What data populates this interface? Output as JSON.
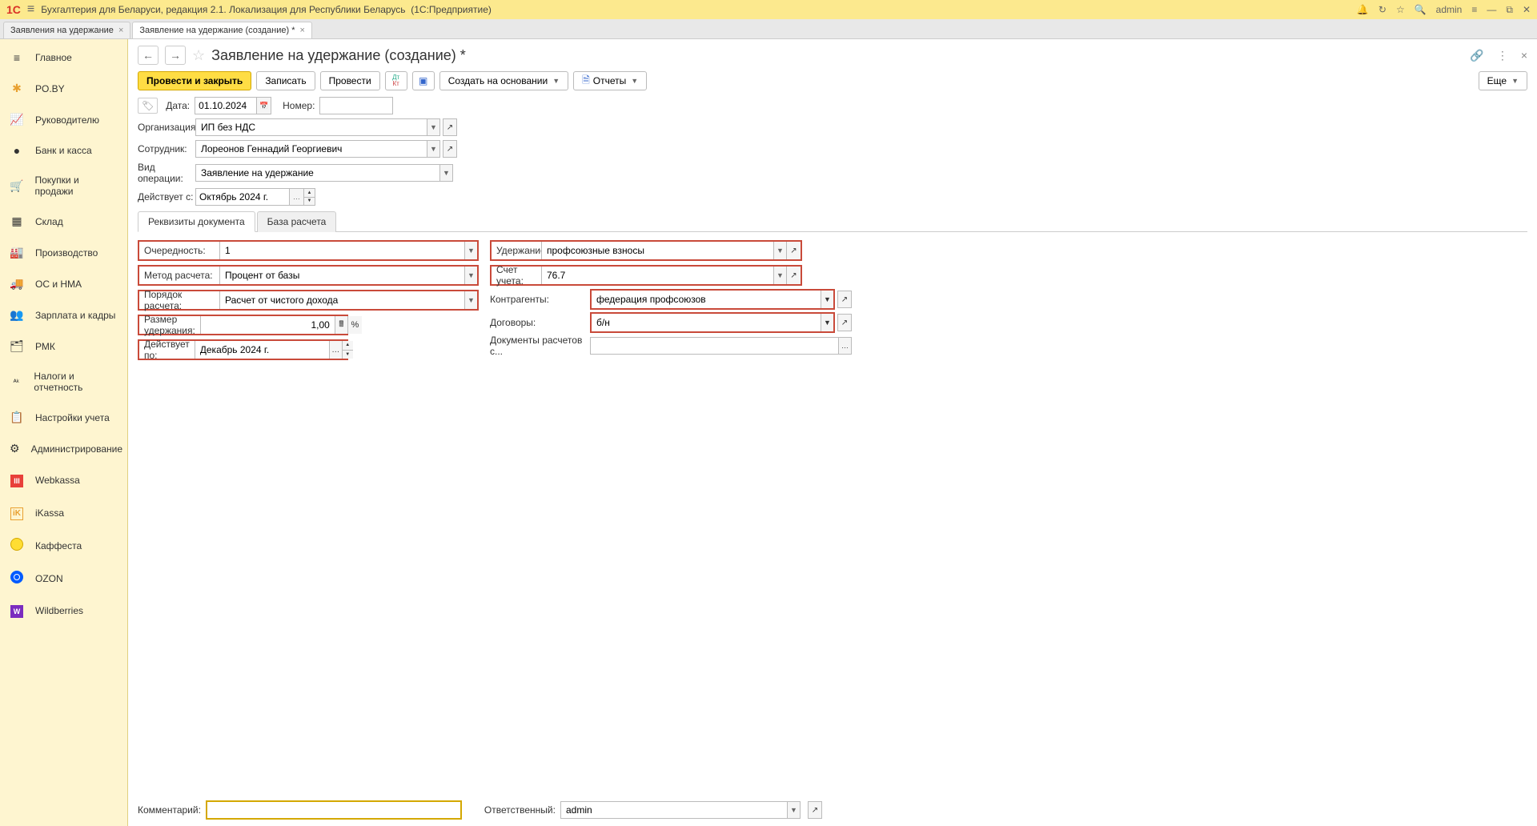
{
  "titlebar": {
    "app_title": "Бухгалтерия для Беларуси, редакция 2.1. Локализация для Республики Беларусь",
    "platform": "(1С:Предприятие)",
    "user": "admin"
  },
  "tabs": [
    {
      "label": "Заявления на удержание"
    },
    {
      "label": "Заявление на удержание (создание) *"
    }
  ],
  "sidebar": [
    {
      "label": "Главное",
      "icon": "≡"
    },
    {
      "label": "PO.BY",
      "icon": "✱"
    },
    {
      "label": "Руководителю",
      "icon": "📈"
    },
    {
      "label": "Банк и касса",
      "icon": "●"
    },
    {
      "label": "Покупки и продажи",
      "icon": "🛒"
    },
    {
      "label": "Склад",
      "icon": "▦"
    },
    {
      "label": "Производство",
      "icon": "🏭"
    },
    {
      "label": "ОС и НМА",
      "icon": "🚚"
    },
    {
      "label": "Зарплата и кадры",
      "icon": "👥"
    },
    {
      "label": "РМК",
      "icon": "🗂"
    },
    {
      "label": "Налоги и отчетность",
      "icon": "ᴬᵏ"
    },
    {
      "label": "Настройки учета",
      "icon": "📋"
    },
    {
      "label": "Администрирование",
      "icon": "⚙"
    },
    {
      "label": "Webkassa",
      "icon": "WK"
    },
    {
      "label": "iKassa",
      "icon": "iK"
    },
    {
      "label": "Каффеста",
      "icon": "●"
    },
    {
      "label": "OZON",
      "icon": "O"
    },
    {
      "label": "Wildberries",
      "icon": "W"
    }
  ],
  "page": {
    "title": "Заявление на удержание (создание) *"
  },
  "toolbar": {
    "post_close": "Провести и закрыть",
    "write": "Записать",
    "post": "Провести",
    "create_based": "Создать на основании",
    "reports": "Отчеты",
    "more": "Еще"
  },
  "header_fields": {
    "date_label": "Дата:",
    "date_value": "01.10.2024",
    "number_label": "Номер:",
    "number_value": "",
    "org_label": "Организация:",
    "org_value": "ИП без НДС",
    "employee_label": "Сотрудник:",
    "employee_value": "Лореонов Геннадий Георгиевич",
    "optype_label": "Вид операции:",
    "optype_value": "Заявление на удержание",
    "valid_from_label": "Действует с:",
    "valid_from_value": "Октябрь 2024 г."
  },
  "doc_tabs": {
    "requisites": "Реквизиты документа",
    "base": "База расчета"
  },
  "left_col": {
    "priority_label": "Очередность:",
    "priority_value": "1",
    "method_label": "Метод расчета:",
    "method_value": "Процент от базы",
    "order_label": "Порядок расчета:",
    "order_value": "Расчет от чистого дохода",
    "size_label": "Размер удержания:",
    "size_value": "1,00",
    "size_unit": "%",
    "valid_to_label": "Действует по:",
    "valid_to_value": "Декабрь 2024 г."
  },
  "right_col": {
    "deduction_label": "Удержание:",
    "deduction_value": "профсоюзные взносы",
    "account_label": "Счет учета:",
    "account_value": "76.7",
    "counterparty_label": "Контрагенты:",
    "counterparty_value": "федерация профсоюзов",
    "contract_label": "Договоры:",
    "contract_value": "б/н",
    "docsettlement_label": "Документы расчетов с...",
    "docsettlement_value": ""
  },
  "footer": {
    "comment_label": "Комментарий:",
    "comment_value": "",
    "responsible_label": "Ответственный:",
    "responsible_value": "admin"
  }
}
